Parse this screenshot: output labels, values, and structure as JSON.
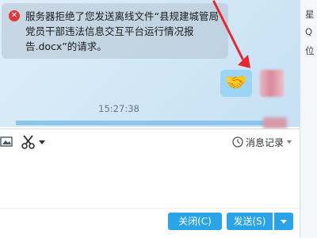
{
  "message": {
    "icon": "error-icon",
    "text": "服务器拒绝了您发送离线文件“县规建城管局党员干部违法信息交互平台运行情况报告.docx”的请求。"
  },
  "timestamp": "15:27:38",
  "progress": 0.97,
  "toolbar": {
    "image_icon": "image-icon",
    "cut_icon": "scissors-icon",
    "history_label": "消息记录"
  },
  "sidebar": {
    "line1": "星",
    "line2": "Q",
    "line3": "位"
  },
  "buttons": {
    "close_label": "关闭(C)",
    "send_label": "发送(S)"
  },
  "colors": {
    "accent": "#2aa4e8",
    "error": "#e0363c",
    "arrow": "#e8262d"
  }
}
